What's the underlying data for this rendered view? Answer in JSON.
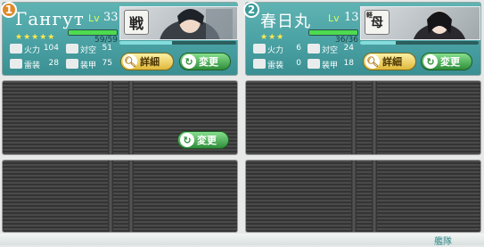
{
  "fleet": {
    "ships": [
      {
        "slot_number": "1",
        "name": "Гангут",
        "level_label": "Lv",
        "level": "33",
        "stars": "★★★★★",
        "hp_text": "59/59",
        "hp_fraction": 1.0,
        "ship_type": "戦",
        "stats": [
          {
            "label": "火力",
            "value": "104"
          },
          {
            "label": "対空",
            "value": "51"
          },
          {
            "label": "雷装",
            "value": "28"
          },
          {
            "label": "装甲",
            "value": "75"
          }
        ],
        "detail_label": "詳細",
        "change_label": "変更"
      },
      {
        "slot_number": "2",
        "name": "春日丸",
        "level_label": "Lv",
        "level": "13",
        "stars": "★★★",
        "hp_text": "36/36",
        "hp_fraction": 1.0,
        "ship_type": "母",
        "ship_type_prefix": "軽",
        "stats": [
          {
            "label": "火力",
            "value": "6"
          },
          {
            "label": "対空",
            "value": "24"
          },
          {
            "label": "雷装",
            "value": "0"
          },
          {
            "label": "装甲",
            "value": "18"
          }
        ],
        "detail_label": "詳細",
        "change_label": "変更"
      }
    ],
    "empty_slot_change_label": "変更",
    "bottom_label": "艦隊"
  },
  "colors": {
    "card_teal": "#4aa1a3",
    "badge_orange": "#e08a2a",
    "badge_teal": "#3c9a9a",
    "hp_green": "#4edb50"
  }
}
